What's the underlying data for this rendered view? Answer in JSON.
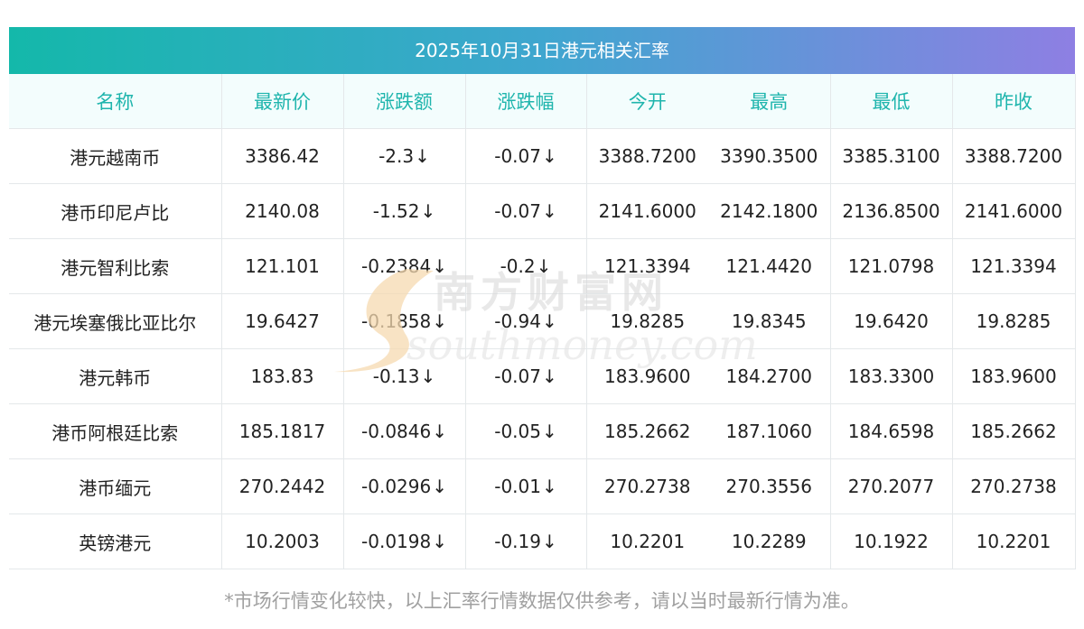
{
  "title": "2025年10月31日港元相关汇率",
  "columns": [
    "名称",
    "最新价",
    "涨跌额",
    "涨跌幅",
    "今开",
    "最高",
    "最低",
    "昨收"
  ],
  "down_arrow": "↓",
  "rows": [
    {
      "name": "港元越南币",
      "latest": "3386.42",
      "change": "-2.3",
      "pct": "-0.07",
      "open": "3388.7200",
      "high": "3390.3500",
      "low": "3385.3100",
      "prev": "3388.7200"
    },
    {
      "name": "港币印尼卢比",
      "latest": "2140.08",
      "change": "-1.52",
      "pct": "-0.07",
      "open": "2141.6000",
      "high": "2142.1800",
      "low": "2136.8500",
      "prev": "2141.6000"
    },
    {
      "name": "港元智利比索",
      "latest": "121.101",
      "change": "-0.2384",
      "pct": "-0.2",
      "open": "121.3394",
      "high": "121.4420",
      "low": "121.0798",
      "prev": "121.3394"
    },
    {
      "name": "港元埃塞俄比亚比尔",
      "latest": "19.6427",
      "change": "-0.1858",
      "pct": "-0.94",
      "open": "19.8285",
      "high": "19.8345",
      "low": "19.6420",
      "prev": "19.8285"
    },
    {
      "name": "港元韩币",
      "latest": "183.83",
      "change": "-0.13",
      "pct": "-0.07",
      "open": "183.9600",
      "high": "184.2700",
      "low": "183.3300",
      "prev": "183.9600"
    },
    {
      "name": "港币阿根廷比索",
      "latest": "185.1817",
      "change": "-0.0846",
      "pct": "-0.05",
      "open": "185.2662",
      "high": "187.1060",
      "low": "184.6598",
      "prev": "185.2662"
    },
    {
      "name": "港币缅元",
      "latest": "270.2442",
      "change": "-0.0296",
      "pct": "-0.01",
      "open": "270.2738",
      "high": "270.3556",
      "low": "270.2077",
      "prev": "270.2738"
    },
    {
      "name": "英镑港元",
      "latest": "10.2003",
      "change": "-0.0198",
      "pct": "-0.19",
      "open": "10.2201",
      "high": "10.2289",
      "low": "10.1922",
      "prev": "10.2201"
    }
  ],
  "watermark": {
    "cn": "南方财富网",
    "en": "southmoney.com"
  },
  "footer": "*市场行情变化较快，以上汇率行情数据仅供参考，请以当时最新行情为准。",
  "colors": {
    "header_text": "#1fb5ad",
    "value_green": "#1a8f1a",
    "title_gradient_start": "#14b8aa",
    "title_gradient_end": "#8e7fe3"
  }
}
